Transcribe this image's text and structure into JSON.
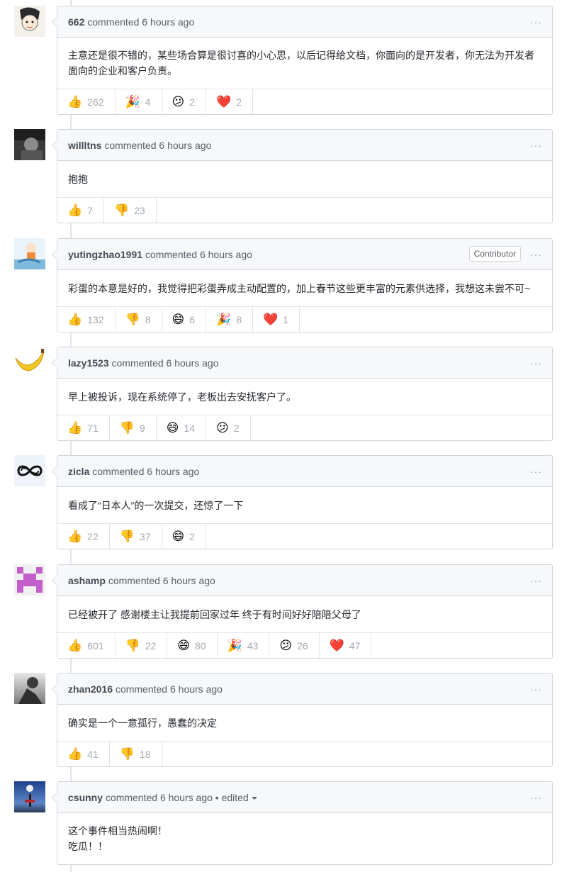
{
  "verb": "commented",
  "menu_glyph": "···",
  "comments": [
    {
      "author": "662",
      "time": "6 hours ago",
      "badge": "",
      "edited": "",
      "body": "主意还是很不错的，某些场合算是很讨喜的小心思，以后记得给文档，你面向的是开发者，你无法为开发者\n面向的企业和客户负责。",
      "reactions": [
        {
          "icon": "thumbs-up-icon",
          "glyph": "👍",
          "count": "262"
        },
        {
          "icon": "tada-icon",
          "glyph": "🎉",
          "count": "4"
        },
        {
          "icon": "confused-icon",
          "glyph": "😕",
          "count": "2"
        },
        {
          "icon": "heart-icon",
          "glyph": "❤️",
          "count": "2"
        }
      ]
    },
    {
      "author": "willltns",
      "time": "6 hours ago",
      "badge": "",
      "edited": "",
      "body": "抱抱",
      "reactions": [
        {
          "icon": "thumbs-up-icon",
          "glyph": "👍",
          "count": "7"
        },
        {
          "icon": "thumbs-down-icon",
          "glyph": "👎",
          "count": "23"
        }
      ]
    },
    {
      "author": "yutingzhao1991",
      "time": "6 hours ago",
      "badge": "Contributor",
      "edited": "",
      "body": "彩蛋的本意是好的，我觉得把彩蛋弄成主动配置的，加上春节这些更丰富的元素供选择，我想这未尝不可~",
      "reactions": [
        {
          "icon": "thumbs-up-icon",
          "glyph": "👍",
          "count": "132"
        },
        {
          "icon": "thumbs-down-icon",
          "glyph": "👎",
          "count": "8"
        },
        {
          "icon": "laugh-icon",
          "glyph": "😄",
          "count": "6"
        },
        {
          "icon": "tada-icon",
          "glyph": "🎉",
          "count": "8"
        },
        {
          "icon": "heart-icon",
          "glyph": "❤️",
          "count": "1"
        }
      ]
    },
    {
      "author": "lazy1523",
      "time": "6 hours ago",
      "badge": "",
      "edited": "",
      "body": "早上被投诉，现在系统停了，老板出去安抚客户了。",
      "reactions": [
        {
          "icon": "thumbs-up-icon",
          "glyph": "👍",
          "count": "71"
        },
        {
          "icon": "thumbs-down-icon",
          "glyph": "👎",
          "count": "9"
        },
        {
          "icon": "laugh-icon",
          "glyph": "😄",
          "count": "14"
        },
        {
          "icon": "confused-icon",
          "glyph": "😕",
          "count": "2"
        }
      ]
    },
    {
      "author": "zicla",
      "time": "6 hours ago",
      "badge": "",
      "edited": "",
      "body": "看成了“日本人”的一次提交，还惊了一下",
      "reactions": [
        {
          "icon": "thumbs-up-icon",
          "glyph": "👍",
          "count": "22"
        },
        {
          "icon": "thumbs-down-icon",
          "glyph": "👎",
          "count": "37"
        },
        {
          "icon": "laugh-icon",
          "glyph": "😄",
          "count": "2"
        }
      ]
    },
    {
      "author": "ashamp",
      "time": "6 hours ago",
      "badge": "",
      "edited": "",
      "body": "已经被开了 感谢楼主让我提前回家过年 终于有时间好好陪陪父母了",
      "reactions": [
        {
          "icon": "thumbs-up-icon",
          "glyph": "👍",
          "count": "601"
        },
        {
          "icon": "thumbs-down-icon",
          "glyph": "👎",
          "count": "22"
        },
        {
          "icon": "laugh-icon",
          "glyph": "😄",
          "count": "80"
        },
        {
          "icon": "tada-icon",
          "glyph": "🎉",
          "count": "43"
        },
        {
          "icon": "confused-icon",
          "glyph": "😕",
          "count": "26"
        },
        {
          "icon": "heart-icon",
          "glyph": "❤️",
          "count": "47"
        }
      ]
    },
    {
      "author": "zhan2016",
      "time": "6 hours ago",
      "badge": "",
      "edited": "",
      "body": "确实是一个一意孤行，愚蠢的决定",
      "reactions": [
        {
          "icon": "thumbs-up-icon",
          "glyph": "👍",
          "count": "41"
        },
        {
          "icon": "thumbs-down-icon",
          "glyph": "👎",
          "count": "18"
        }
      ]
    },
    {
      "author": "csunny",
      "time": "6 hours ago",
      "badge": "",
      "edited": "• edited",
      "body": "这个事件相当热闹啊！\n吃瓜！！",
      "reactions": []
    }
  ]
}
